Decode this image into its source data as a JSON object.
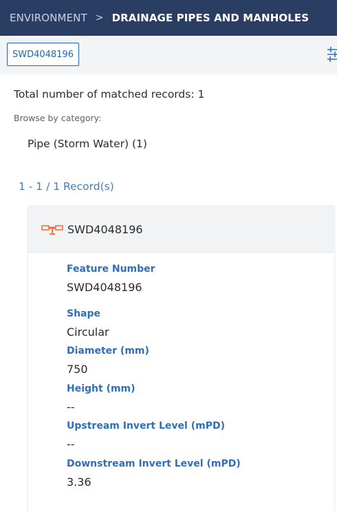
{
  "breadcrumb": {
    "root": "ENVIRONMENT",
    "separator": ">",
    "current": "DRAINAGE PIPES AND MANHOLES"
  },
  "search": {
    "chip_label": "SWD4048196"
  },
  "toolbar": {
    "filter_icon": "filter-sliders-icon"
  },
  "results": {
    "summary": "Total number of matched records: 1",
    "browse_label": "Browse by category:",
    "categories": [
      {
        "label": "Pipe (Storm Water) (1)"
      }
    ],
    "pagination": "1 - 1 / 1 Record(s)"
  },
  "record": {
    "icon": "storm-water-pipe-icon",
    "icon_color": "#f26b3a",
    "title": "SWD4048196",
    "fields": [
      {
        "label": "Feature Number",
        "value": "SWD4048196"
      },
      {
        "label": "Shape",
        "value": "Circular"
      },
      {
        "label": "Diameter (mm)",
        "value": "750"
      },
      {
        "label": "Height (mm)",
        "value": "--"
      },
      {
        "label": "Upstream Invert Level (mPD)",
        "value": "--"
      },
      {
        "label": "Downstream Invert Level (mPD)",
        "value": "3.36"
      }
    ]
  },
  "colors": {
    "header_bg": "#2a3d63",
    "accent": "#1f67b1",
    "link": "#3d7fc0"
  }
}
